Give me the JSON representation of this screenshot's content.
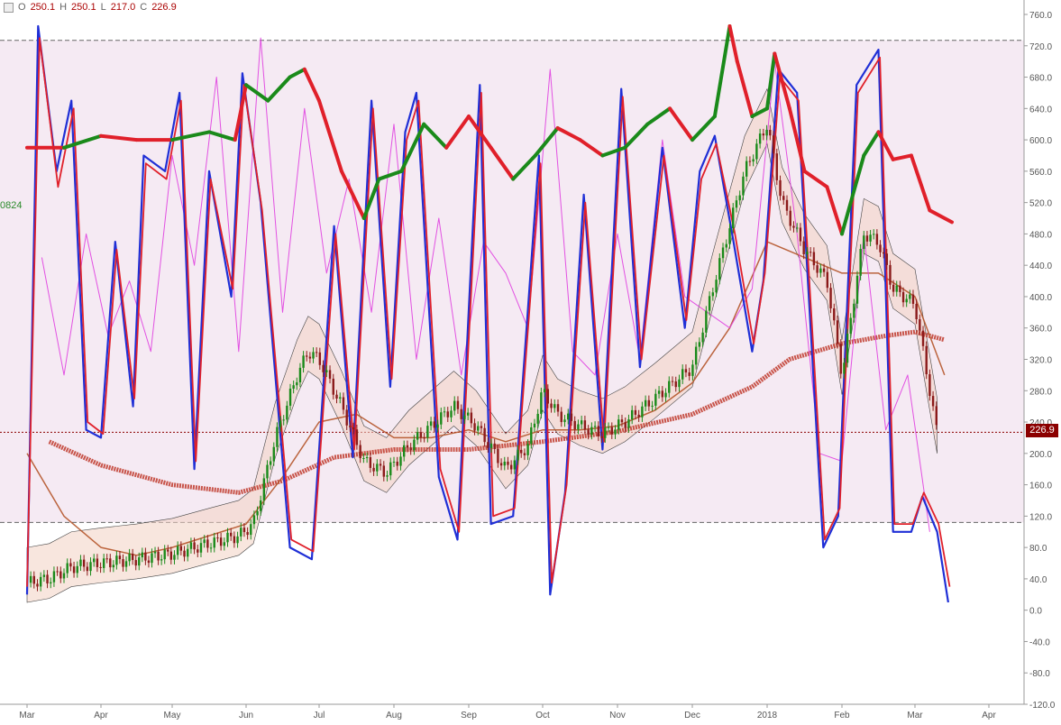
{
  "ohlc": {
    "open_label": "O",
    "open": "250.1",
    "high_label": "H",
    "high": "250.1",
    "low_label": "L",
    "low": "217.0",
    "close_label": "C",
    "close": "226.9"
  },
  "side_value": "0824",
  "last_price_tag": "226.9",
  "colors": {
    "band_fill": "#f5eaf3",
    "price_up": "#1a8a1a",
    "price_down": "#8b1a1a",
    "blue_line": "#1f2fd6",
    "red_line": "#e0202a",
    "magenta_line": "#e040e0",
    "ma200": "#c0392b",
    "ma_brown": "#b5552a",
    "cloud_fill": "#f2d2c2",
    "level_dash": "#666666"
  },
  "chart_data": {
    "type": "line",
    "title": "",
    "xlabel": "",
    "ylabel": "",
    "ylim": [
      -120,
      760
    ],
    "y_ticks": [
      "760.0",
      "720.0",
      "680.0",
      "640.0",
      "600.0",
      "560.0",
      "520.0",
      "480.0",
      "440.0",
      "400.0",
      "360.0",
      "320.0",
      "280.0",
      "240.0",
      "200.0",
      "160.0",
      "120.0",
      "80.0",
      "40.0",
      "0.0",
      "-40.0",
      "-80.0",
      "-120.0"
    ],
    "x_ticks": [
      "Mar",
      "Apr",
      "May",
      "Jun",
      "Jul",
      "Aug",
      "Sep",
      "Oct",
      "Nov",
      "Dec",
      "2018",
      "Feb",
      "Mar",
      "Apr"
    ],
    "x_range": [
      0,
      13.3
    ],
    "band": [
      112,
      727
    ],
    "last_price": 226.9,
    "series": [
      {
        "key": "price",
        "color": "#1a8a1a",
        "x": [
          0,
          0.3,
          0.6,
          1,
          1.5,
          2,
          2.5,
          2.9,
          3.1,
          3.4,
          3.7,
          3.85,
          4.0,
          4.3,
          4.6,
          4.9,
          5.2,
          5.5,
          5.8,
          6.1,
          6.5,
          6.8,
          7.0,
          7.2,
          7.5,
          7.8,
          8.1,
          8.5,
          9.0,
          9.3,
          9.7,
          10.0,
          10.2,
          10.5,
          10.8,
          11.0,
          11.3,
          11.5,
          11.7,
          12.0,
          12.3
        ],
        "y": [
          35,
          40,
          55,
          60,
          65,
          72,
          85,
          95,
          110,
          220,
          300,
          330,
          320,
          260,
          190,
          175,
          210,
          235,
          260,
          235,
          180,
          210,
          280,
          250,
          235,
          225,
          240,
          270,
          310,
          420,
          560,
          620,
          520,
          460,
          420,
          300,
          480,
          470,
          410,
          390,
          225
        ]
      },
      {
        "key": "blue_osc",
        "color": "#1f2fd6",
        "x": [
          0,
          0.15,
          0.4,
          0.6,
          0.8,
          1.0,
          1.2,
          1.45,
          1.6,
          1.9,
          2.1,
          2.3,
          2.5,
          2.8,
          2.95,
          3.2,
          3.6,
          3.9,
          4.2,
          4.45,
          4.7,
          4.95,
          5.15,
          5.3,
          5.6,
          5.85,
          6.15,
          6.3,
          6.6,
          6.95,
          7.1,
          7.3,
          7.55,
          7.8,
          8.05,
          8.3,
          8.6,
          8.9,
          9.1,
          9.3,
          9.55,
          9.8,
          9.95,
          10.15,
          10.4,
          10.75,
          10.95,
          11.2,
          11.5,
          11.7,
          11.95,
          12.1,
          12.3,
          12.45
        ],
        "y": [
          20,
          745,
          560,
          650,
          230,
          220,
          470,
          260,
          580,
          560,
          660,
          180,
          560,
          400,
          685,
          520,
          80,
          65,
          490,
          195,
          650,
          285,
          610,
          660,
          170,
          90,
          670,
          110,
          120,
          580,
          20,
          150,
          530,
          205,
          665,
          310,
          590,
          360,
          560,
          605,
          470,
          330,
          420,
          690,
          660,
          80,
          120,
          670,
          715,
          100,
          100,
          145,
          100,
          10
        ]
      },
      {
        "key": "red_osc",
        "color": "#e0202a",
        "x": [
          0,
          0.17,
          0.42,
          0.63,
          0.82,
          1.03,
          1.22,
          1.47,
          1.63,
          1.92,
          2.12,
          2.32,
          2.52,
          2.82,
          2.97,
          3.22,
          3.62,
          3.92,
          4.22,
          4.47,
          4.72,
          4.97,
          5.17,
          5.33,
          5.62,
          5.87,
          6.17,
          6.33,
          6.62,
          6.97,
          7.12,
          7.32,
          7.57,
          7.82,
          8.07,
          8.32,
          8.62,
          8.92,
          9.12,
          9.32,
          9.57,
          9.82,
          9.97,
          10.17,
          10.42,
          10.77,
          10.97,
          11.22,
          11.52,
          11.72,
          11.97,
          12.12,
          12.32,
          12.47
        ],
        "y": [
          30,
          730,
          540,
          640,
          240,
          225,
          460,
          270,
          570,
          550,
          650,
          190,
          550,
          410,
          670,
          510,
          90,
          75,
          480,
          205,
          640,
          295,
          600,
          650,
          180,
          100,
          660,
          120,
          130,
          570,
          35,
          160,
          520,
          215,
          655,
          320,
          580,
          370,
          550,
          595,
          480,
          340,
          430,
          680,
          650,
          90,
          130,
          660,
          705,
          110,
          110,
          150,
          110,
          30
        ]
      },
      {
        "key": "magenta_osc",
        "color": "#e040e0",
        "x": [
          0.2,
          0.5,
          0.8,
          1.1,
          1.4,
          1.7,
          2.0,
          2.3,
          2.6,
          2.9,
          3.2,
          3.5,
          3.8,
          4.1,
          4.4,
          4.7,
          5.0,
          5.3,
          5.6,
          5.9,
          6.2,
          6.5,
          6.8,
          7.1,
          7.4,
          7.7,
          8.0,
          8.3,
          8.6,
          8.9,
          9.2,
          9.5,
          9.8,
          10.1,
          10.4,
          10.7,
          11.0,
          11.3,
          11.6,
          11.9,
          12.2
        ],
        "y": [
          450,
          300,
          480,
          350,
          420,
          330,
          580,
          440,
          680,
          330,
          730,
          380,
          640,
          430,
          550,
          380,
          620,
          320,
          500,
          300,
          470,
          430,
          360,
          690,
          330,
          300,
          480,
          320,
          600,
          400,
          380,
          360,
          410,
          700,
          480,
          200,
          190,
          480,
          230,
          300,
          100
        ]
      },
      {
        "key": "ma_200",
        "color": "#c0392b",
        "x": [
          0.3,
          1.0,
          2.0,
          2.9,
          3.5,
          4.2,
          5.0,
          6.0,
          7.0,
          8.0,
          9.0,
          9.8,
          10.3,
          11.0,
          11.6,
          12.0,
          12.4
        ],
        "y": [
          215,
          185,
          160,
          150,
          165,
          195,
          205,
          205,
          215,
          228,
          250,
          285,
          320,
          340,
          350,
          355,
          345
        ]
      },
      {
        "key": "ma_brown",
        "color": "#b5552a",
        "x": [
          0,
          0.5,
          1.0,
          1.5,
          2.0,
          2.5,
          3.0,
          3.5,
          4.0,
          4.5,
          5.0,
          5.5,
          6.0,
          6.5,
          7.0,
          7.5,
          8.0,
          8.5,
          9.0,
          9.5,
          10.0,
          10.5,
          11.0,
          11.5,
          12.0,
          12.4
        ],
        "y": [
          200,
          120,
          80,
          70,
          80,
          95,
          110,
          170,
          240,
          250,
          220,
          220,
          230,
          215,
          230,
          230,
          235,
          255,
          290,
          360,
          470,
          450,
          430,
          430,
          400,
          300
        ]
      },
      {
        "key": "stoch_trend",
        "colors": [
          "#e0202a",
          "#1a8a1a"
        ],
        "x": [
          0,
          0.5,
          1.0,
          1.5,
          2.0,
          2.5,
          2.85,
          3.0,
          3.3,
          3.6,
          3.8,
          4.0,
          4.3,
          4.6,
          4.8,
          5.1,
          5.4,
          5.7,
          6.0,
          6.3,
          6.6,
          6.9,
          7.2,
          7.5,
          7.8,
          8.1,
          8.4,
          8.7,
          9.0,
          9.3,
          9.5,
          9.6,
          9.8,
          10.0,
          10.1,
          10.3,
          10.5,
          10.8,
          11.0,
          11.3,
          11.5,
          11.7,
          11.95,
          12.2,
          12.5
        ],
        "y": [
          590,
          590,
          605,
          600,
          600,
          610,
          600,
          670,
          650,
          680,
          690,
          650,
          560,
          500,
          550,
          560,
          620,
          590,
          630,
          590,
          550,
          580,
          615,
          600,
          580,
          590,
          620,
          640,
          600,
          630,
          745,
          700,
          630,
          640,
          710,
          640,
          560,
          540,
          480,
          580,
          610,
          575,
          580,
          510,
          495
        ],
        "up": [
          false,
          true,
          false,
          false,
          true,
          true,
          false,
          true,
          true,
          true,
          false,
          false,
          false,
          true,
          true,
          true,
          true,
          false,
          false,
          false,
          true,
          true,
          false,
          false,
          true,
          true,
          true,
          false,
          true,
          true,
          false,
          false,
          true,
          true,
          false,
          false,
          false,
          false,
          true,
          true,
          false,
          false,
          false,
          false
        ]
      }
    ]
  }
}
